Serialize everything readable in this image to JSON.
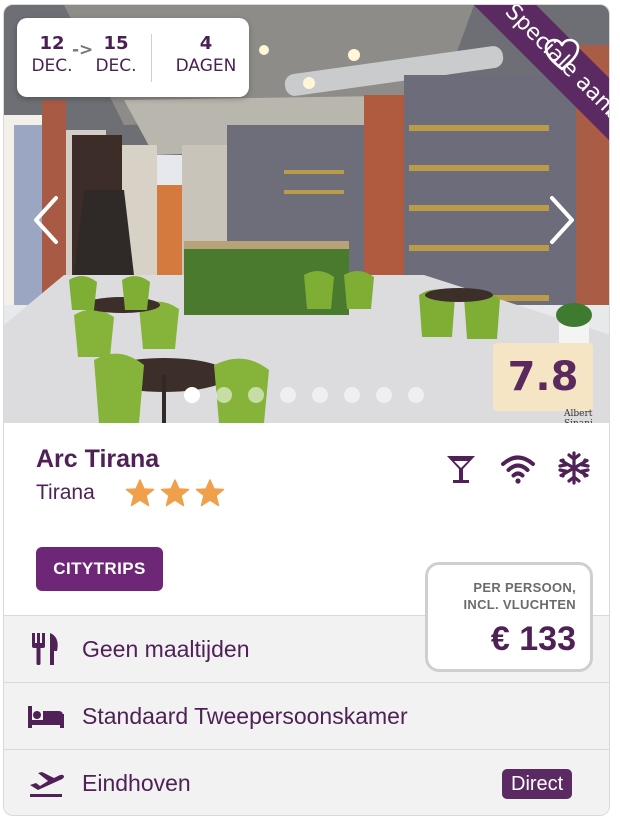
{
  "dates": {
    "from_day": "12",
    "from_month": "DEC.",
    "arrow": "->",
    "to_day": "15",
    "to_month": "DEC.",
    "days_count": "4",
    "days_label": "DAGEN"
  },
  "ribbon": "Speciale aanbieding",
  "photo_credit": "Albert Sinani",
  "score": "7.8",
  "carousel": {
    "total_slides": 8,
    "active_index": 0
  },
  "hotel": {
    "name": "Arc Tirana",
    "city": "Tirana",
    "stars": 3
  },
  "amenities": [
    "bar-icon",
    "wifi-icon",
    "airco-icon"
  ],
  "tag": "CITYTRIPS",
  "price": {
    "label_line1": "PER PERSOON,",
    "label_line2": "INCL. VLUCHTEN",
    "value": "€ 133"
  },
  "details": {
    "meals": "Geen maaltijden",
    "room": "Standaard Tweepersoonskamer",
    "departure": "Eindhoven",
    "flight_type": "Direct"
  },
  "colors": {
    "primary": "#4f2156",
    "tag_bg": "#6e2677",
    "ribbon_bg": "#5c2a63",
    "score_bg": "#f5e5c4",
    "star": "#f0a04b",
    "row_bg": "#f2f2f2"
  }
}
